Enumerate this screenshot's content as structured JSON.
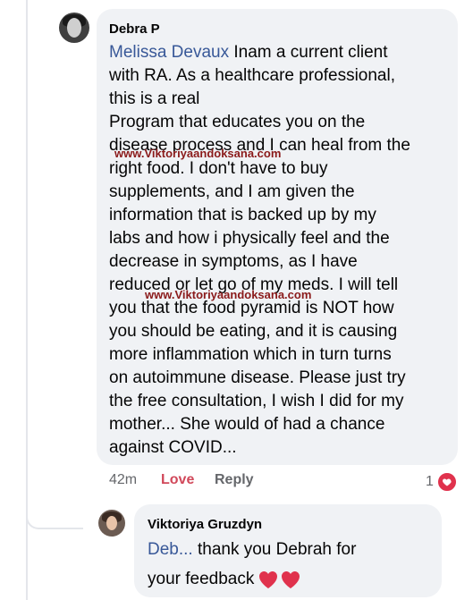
{
  "comment": {
    "author": "Debra P",
    "mention": "Melissa Devaux",
    "lines": [
      " Inam a current client",
      "with RA.  As a healthcare professional,",
      "this is a real",
      "Program that educates you on the",
      "disease process and I can heal from the",
      "right food. I don't have to buy",
      "supplements, and I am given the",
      "information that is backed up by my",
      "labs and how i physically feel and the",
      "decrease in symptoms, as I have",
      "reduced or let go of my meds.  I will tell",
      "you that the food pyramid is NOT how",
      "you should be eating, and it is causing",
      "more inflammation which in turn turns",
      "on autoimmune disease.  Please just try",
      "the free consultation, I wish I did for my",
      "mother... She would of had a chance",
      "against COVID..."
    ],
    "time": "42m",
    "love_label": "Love",
    "reply_label": "Reply",
    "reaction_count": "1"
  },
  "watermarks": [
    "www.Viktoriyaandoksana.com",
    "www.Viktoriyaandoksana.com"
  ],
  "reply": {
    "author": "Viktoriya Gruzdyn",
    "mention": "Deb...",
    "line1": " thank you Debrah for",
    "line2": "your feedback"
  },
  "colors": {
    "bubble": "#f0f2f5",
    "mention": "#385898",
    "love": "#d1485a",
    "heart": "#e0324d"
  },
  "icons": [
    "heart-reaction-icon",
    "red-heart-emoji"
  ]
}
